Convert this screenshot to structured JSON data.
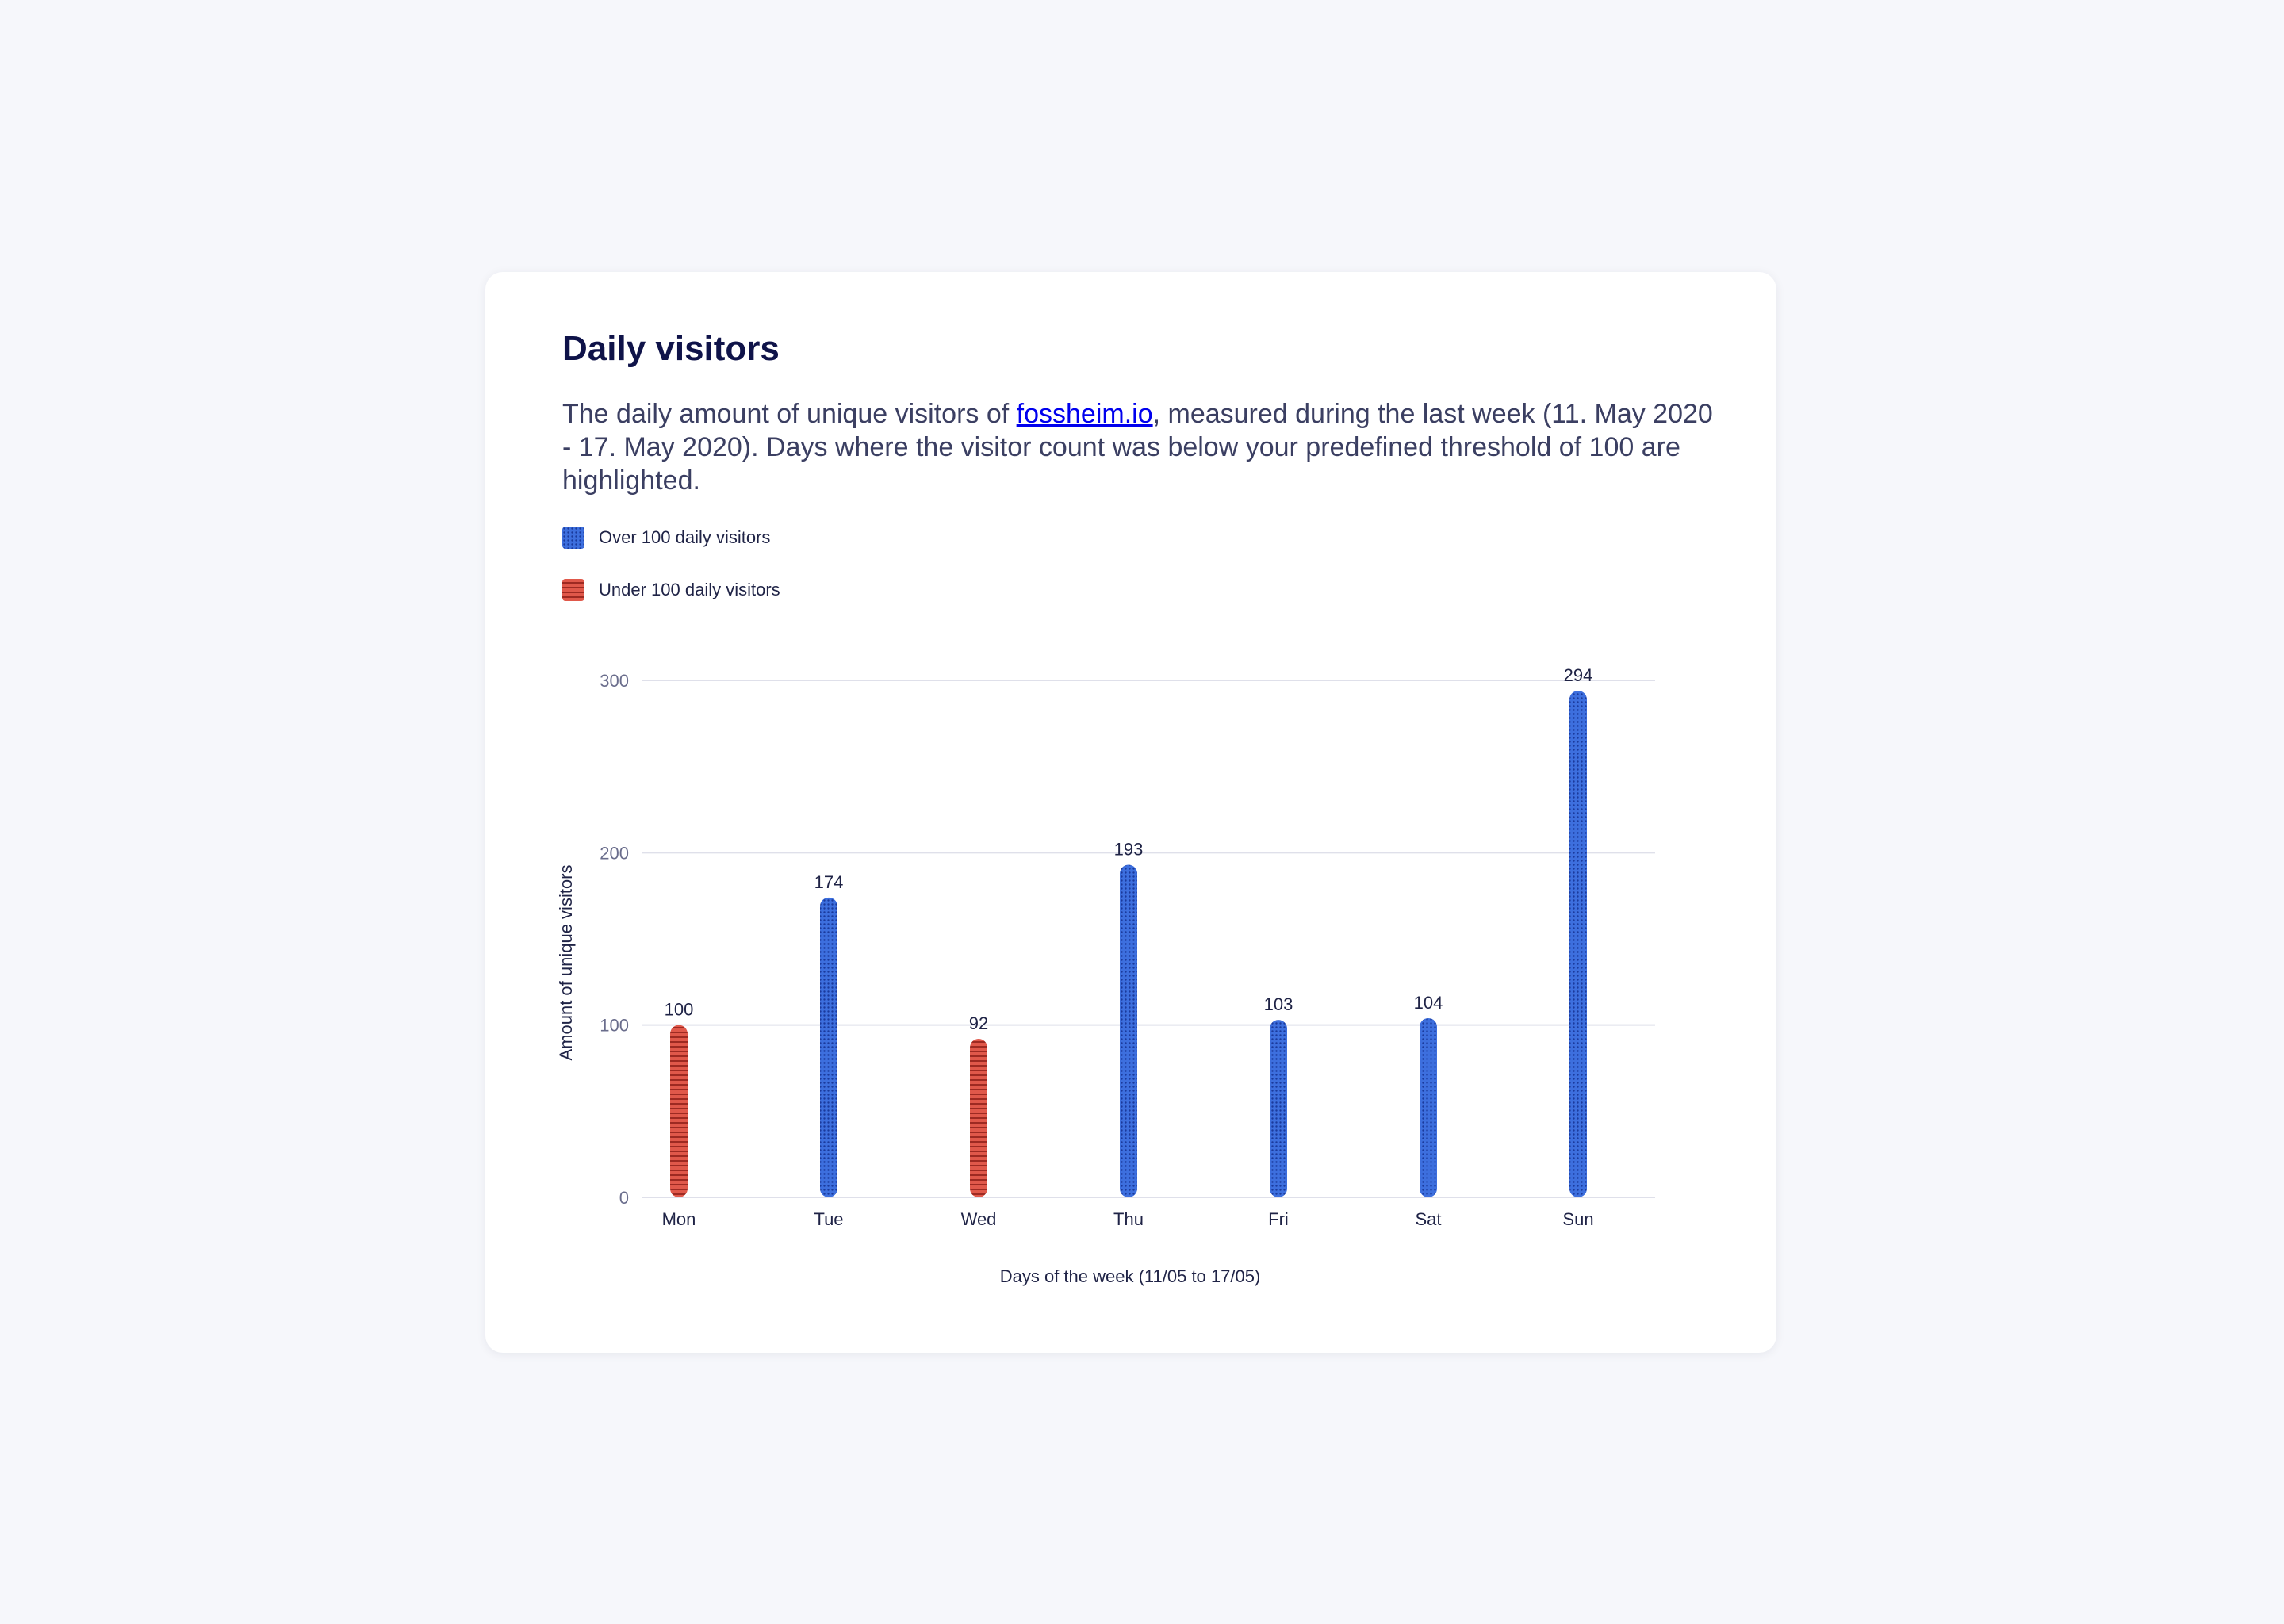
{
  "card": {
    "title": "Daily visitors",
    "description_before": "The daily amount of unique visitors of ",
    "description_link": "fossheim.io",
    "description_after": ", measured during the last week (11. May 2020 - 17. May 2020). Days where the visitor count was below your predefined threshold of 100 are highlighted."
  },
  "legend": [
    {
      "label": "Over 100 daily visitors",
      "pattern": "dots",
      "color": "#3d6fde"
    },
    {
      "label": "Under 100 daily visitors",
      "pattern": "stripes",
      "color": "#d9483b"
    }
  ],
  "chart_data": {
    "type": "bar",
    "title": "",
    "xlabel": "Days of the week (11/05 to 17/05)",
    "ylabel": "Amount of unique visitors",
    "ylim": [
      0,
      300
    ],
    "yticks": [
      0,
      100,
      200,
      300
    ],
    "grid": true,
    "legend_position": "top-left",
    "threshold": 100,
    "categories": [
      "Mon",
      "Tue",
      "Wed",
      "Thu",
      "Fri",
      "Sat",
      "Sun"
    ],
    "values": [
      100,
      174,
      92,
      193,
      103,
      104,
      294
    ],
    "colors": {
      "over": "#3d6fde",
      "under": "#d9483b"
    }
  }
}
